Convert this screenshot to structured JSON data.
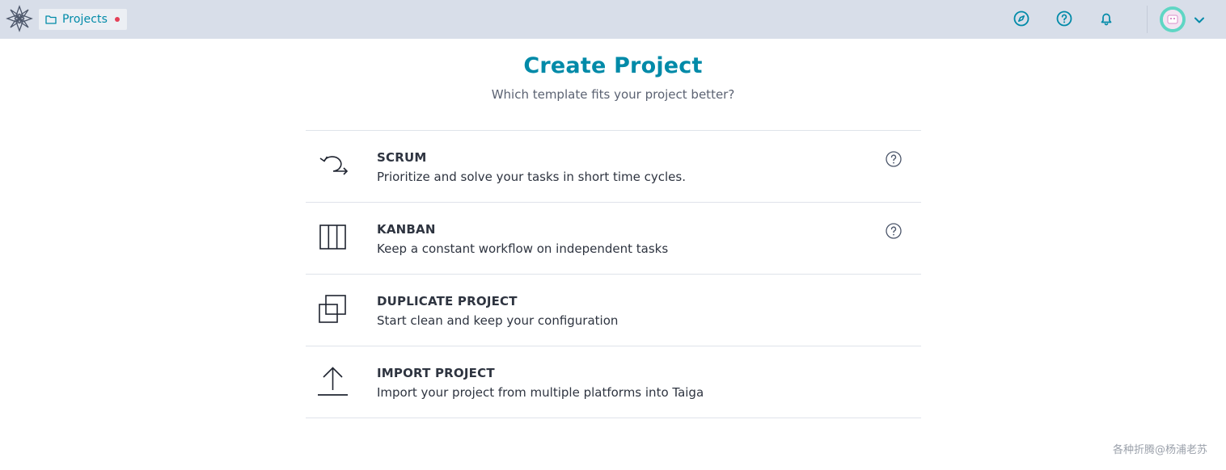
{
  "header": {
    "projects_label": "Projects",
    "colors": {
      "bar": "#d8dee9",
      "accent": "#008aa8",
      "notification_dot": "#e44057"
    },
    "icons": [
      "taiga-logo-icon",
      "folder-icon",
      "discover-compass-icon",
      "help-icon",
      "notifications-bell-icon",
      "chevron-down-icon"
    ]
  },
  "main": {
    "title": "Create Project",
    "subtitle": "Which template fits your project better?",
    "templates": [
      {
        "name": "SCRUM",
        "description": "Prioritize and solve your tasks in short time cycles.",
        "icon": "scrum-cycle-icon",
        "has_help": true
      },
      {
        "name": "KANBAN",
        "description": "Keep a constant workflow on independent tasks",
        "icon": "kanban-columns-icon",
        "has_help": true
      },
      {
        "name": "DUPLICATE PROJECT",
        "description": "Start clean and keep your configuration",
        "icon": "duplicate-icon",
        "has_help": false
      },
      {
        "name": "IMPORT PROJECT",
        "description": "Import your project from multiple platforms into Taiga",
        "icon": "upload-icon",
        "has_help": false
      }
    ]
  },
  "watermark": "各种折腾@杨浦老苏"
}
